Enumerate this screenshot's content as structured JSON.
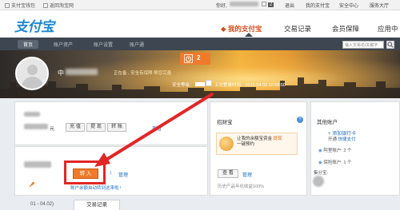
{
  "topbar": {
    "left_items": [
      "支付宝钱包",
      "返回淘宝网"
    ],
    "greeting": "你好,",
    "msg_count": "2",
    "right_items": [
      "退出",
      "我的支付宝",
      "安全中心",
      "服务大厅"
    ]
  },
  "header": {
    "logo_text": "支付宝",
    "nav": [
      "我的支付宝",
      "交易记录",
      "会员保障",
      "应用中"
    ]
  },
  "subnav": {
    "tabs": [
      "首页",
      "账户资产",
      "账户设置",
      "账户通"
    ],
    "search_placeholder": "输入交易名/关键字"
  },
  "profile": {
    "name_prefix": "中",
    "tip": "正在备 , 安全有保障 帮您完善",
    "alarm_count": "2",
    "security_label": "安全等级：",
    "last_login": "上次登录时间：2015.04.02 10:59:50"
  },
  "balance_card": {
    "unit": "元",
    "buttons": [
      "充 值",
      "提 现",
      "转 账"
    ],
    "link": "查看"
  },
  "yuebao_card": {
    "transfer_in": "转 入",
    "manage": "管理",
    "note": "账户余额自动转到这来啦 !"
  },
  "zhaocaibao": {
    "title": "招财宝",
    "ad_line1": "让我的余额宝资金 ",
    "ad_hl": "提现",
    "ad_line2": "一键预约",
    "view_btn": "查 看",
    "manage": "管理",
    "yield_note": "历史产品年化收益100%"
  },
  "other_accounts": {
    "title": "其他账户",
    "add_card": "+ 添加银行卡",
    "open_kj": "开通",
    "kj_link": "快捷支付",
    "alipay_accounts": "阿里账户: 2 个",
    "insurance": "保险账户: 1 个",
    "points": "集分宝:"
  },
  "bottom": {
    "date_range": "01 - 04.02)",
    "active_tab": "交易记录"
  }
}
